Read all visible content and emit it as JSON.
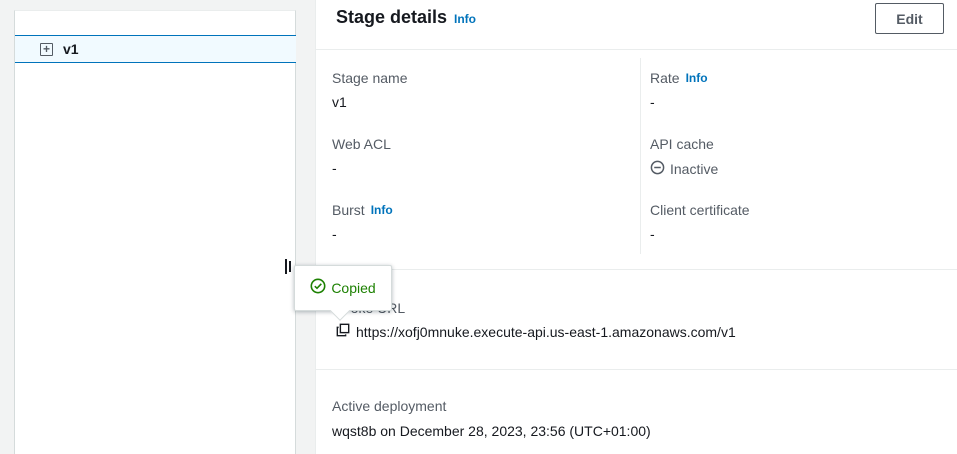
{
  "tree": {
    "items": [
      {
        "label": "v1",
        "expand_symbol": "+"
      }
    ]
  },
  "stage_details": {
    "title": "Stage details",
    "info_label": "Info",
    "edit_label": "Edit",
    "fields": {
      "stage_name": {
        "label": "Stage name",
        "value": "v1"
      },
      "rate": {
        "label": "Rate",
        "info": "Info",
        "value": "-"
      },
      "web_acl": {
        "label": "Web ACL",
        "value": "-"
      },
      "api_cache": {
        "label": "API cache",
        "value": "Inactive",
        "icon": "inactive-circle-icon"
      },
      "burst": {
        "label": "Burst",
        "info": "Info",
        "value": "-"
      },
      "client_certificate": {
        "label": "Client certificate",
        "value": "-"
      }
    },
    "invoke_url": {
      "label": "Invoke URL",
      "value": "https://xofj0mnuke.execute-api.us-east-1.amazonaws.com/v1",
      "icon": "copy-icon"
    },
    "active_deployment": {
      "label": "Active deployment",
      "value": "wqst8b on December 28, 2023, 23:56 (UTC+01:00)"
    }
  },
  "popover": {
    "text": "Copied",
    "icon": "check-circle-icon",
    "color": "#1d8102"
  },
  "colors": {
    "accent": "#0073bb",
    "success": "#1d8102",
    "selected_bg": "#f1faff"
  }
}
